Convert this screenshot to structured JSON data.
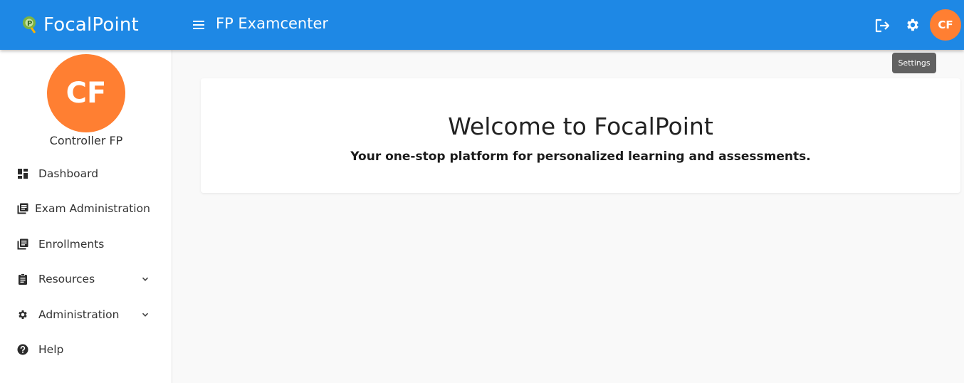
{
  "header": {
    "brand_name": "FocalPoint",
    "app_title": "FP Examcenter",
    "avatar_initials": "CF",
    "accent_color": "#1e88e5",
    "avatar_color": "#ff7f32"
  },
  "tooltip": {
    "text": "Settings"
  },
  "sidebar": {
    "avatar_initials": "CF",
    "user_name": "Controller FP",
    "items": [
      {
        "label": "Dashboard",
        "icon": "dashboard-icon"
      },
      {
        "label": "Exam Administration",
        "icon": "library-books-icon"
      },
      {
        "label": "Enrollments",
        "icon": "library-books-icon"
      },
      {
        "label": "Resources",
        "icon": "assignment-icon",
        "expandable": true
      },
      {
        "label": "Administration",
        "icon": "gear-icon",
        "expandable": true
      },
      {
        "label": "Help",
        "icon": "help-circle-icon"
      }
    ]
  },
  "main": {
    "welcome_title": "Welcome to FocalPoint",
    "welcome_subtitle": "Your one-stop platform for personalized learning and assessments."
  }
}
